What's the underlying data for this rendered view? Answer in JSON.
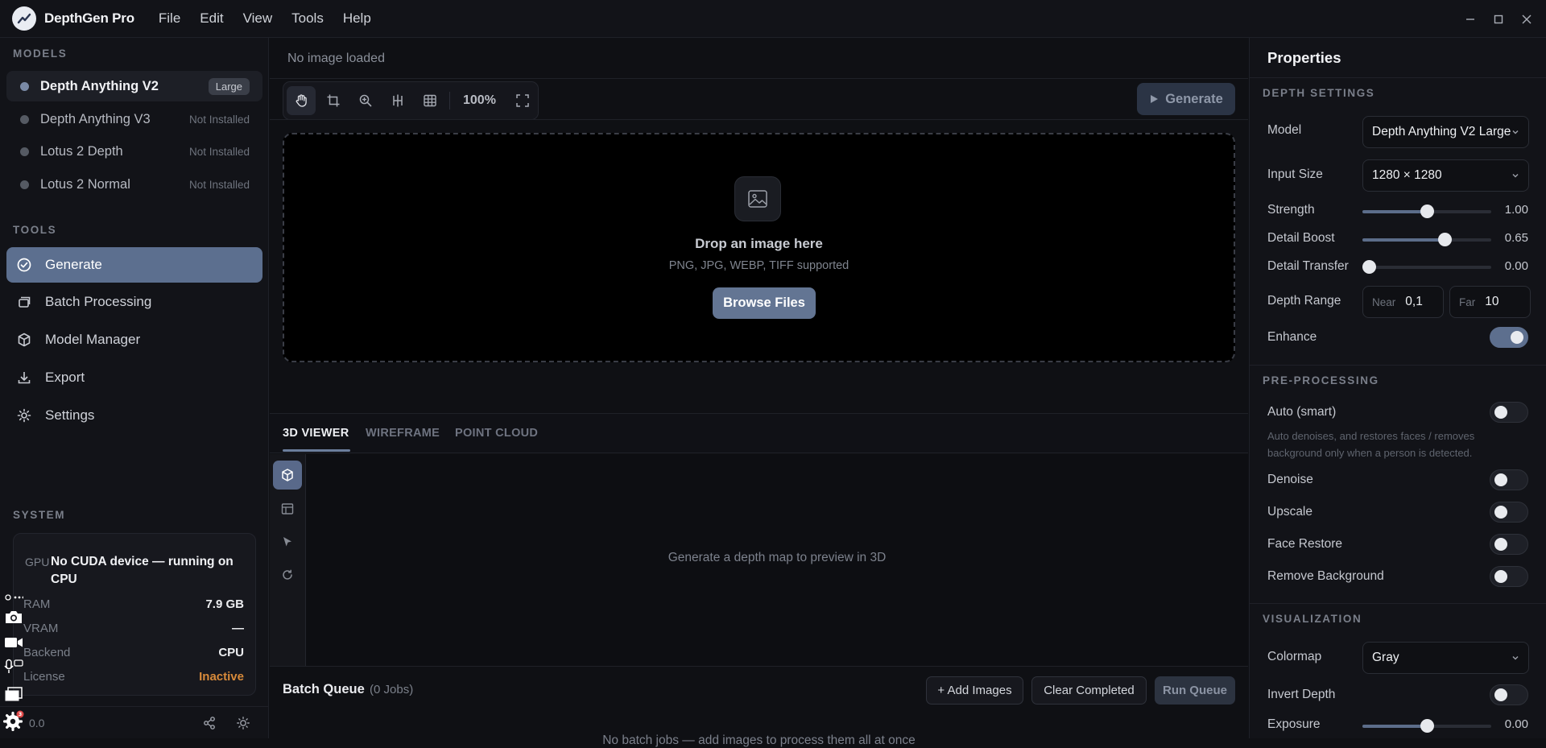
{
  "app": {
    "name": "DepthGen Pro"
  },
  "menu": [
    "File",
    "Edit",
    "View",
    "Tools",
    "Help"
  ],
  "sidebar": {
    "models_title": "MODELS",
    "models": [
      {
        "name": "Depth Anything V2",
        "status": "Large",
        "active": true
      },
      {
        "name": "Depth Anything V3",
        "status": "Not Installed",
        "active": false
      },
      {
        "name": "Lotus 2 Depth",
        "status": "Not Installed",
        "active": false
      },
      {
        "name": "Lotus 2 Normal",
        "status": "Not Installed",
        "active": false
      }
    ],
    "tools_title": "TOOLS",
    "tools": [
      {
        "label": "Generate",
        "icon": "check-circle-icon",
        "active": true
      },
      {
        "label": "Batch Processing",
        "icon": "layers-icon",
        "active": false
      },
      {
        "label": "Model Manager",
        "icon": "cube-icon",
        "active": false
      },
      {
        "label": "Export",
        "icon": "download-icon",
        "active": false
      },
      {
        "label": "Settings",
        "icon": "gear-icon",
        "active": false
      }
    ],
    "system_title": "SYSTEM",
    "system": {
      "gpu_key": "GPU",
      "gpu_value": "No CUDA device — running on CPU",
      "ram_key": "RAM",
      "ram_value": "7.9 GB",
      "vram_key": "VRAM",
      "vram_value": "—",
      "backend_key": "Backend",
      "backend_value": "CPU",
      "license_key": "License",
      "license_value": "Inactive"
    },
    "version": "0.0",
    "tray_badge": "3"
  },
  "center": {
    "image_status": "No image loaded",
    "zoom": "100%",
    "generate_label": "Generate",
    "dropzone": {
      "title": "Drop an image here",
      "subtitle": "PNG, JPG, WEBP, TIFF supported",
      "browse_label": "Browse Files"
    },
    "viewer_tabs": [
      "3D VIEWER",
      "WIREFRAME",
      "POINT CLOUD"
    ],
    "viewer_message": "Generate a depth map to preview in 3D",
    "batch": {
      "title": "Batch Queue",
      "count": "(0 Jobs)",
      "add_label": "+ Add Images",
      "clear_label": "Clear Completed",
      "run_label": "Run Queue",
      "empty_message": "No batch jobs — add images to process them all at once"
    }
  },
  "properties": {
    "title": "Properties",
    "depth_settings": {
      "title": "DEPTH SETTINGS",
      "model_label": "Model",
      "model_value": "Depth Anything V2 Large",
      "input_size_label": "Input Size",
      "input_size_value": "1280 × 1280",
      "strength_label": "Strength",
      "strength_value": "1.00",
      "strength_level": 0.5,
      "detail_boost_label": "Detail Boost",
      "detail_boost_value": "0.65",
      "detail_boost_level": 0.64,
      "detail_transfer_label": "Detail Transfer",
      "detail_transfer_value": "0.00",
      "detail_transfer_level": 0.05,
      "depth_range_label": "Depth Range",
      "near_label": "Near",
      "near_value": "0,1",
      "far_label": "Far",
      "far_value": "10",
      "enhance_label": "Enhance",
      "enhance_on": true
    },
    "pre_processing": {
      "title": "PRE-PROCESSING",
      "auto_label": "Auto (smart)",
      "auto_note": "Auto denoises, and restores faces / removes background only when a person is detected.",
      "denoise_label": "Denoise",
      "upscale_label": "Upscale",
      "face_restore_label": "Face Restore",
      "remove_bg_label": "Remove Background"
    },
    "visualization": {
      "title": "VISUALIZATION",
      "colormap_label": "Colormap",
      "colormap_value": "Gray",
      "invert_label": "Invert Depth",
      "exposure_label": "Exposure",
      "exposure_value": "0.00",
      "exposure_level": 0.5
    }
  }
}
